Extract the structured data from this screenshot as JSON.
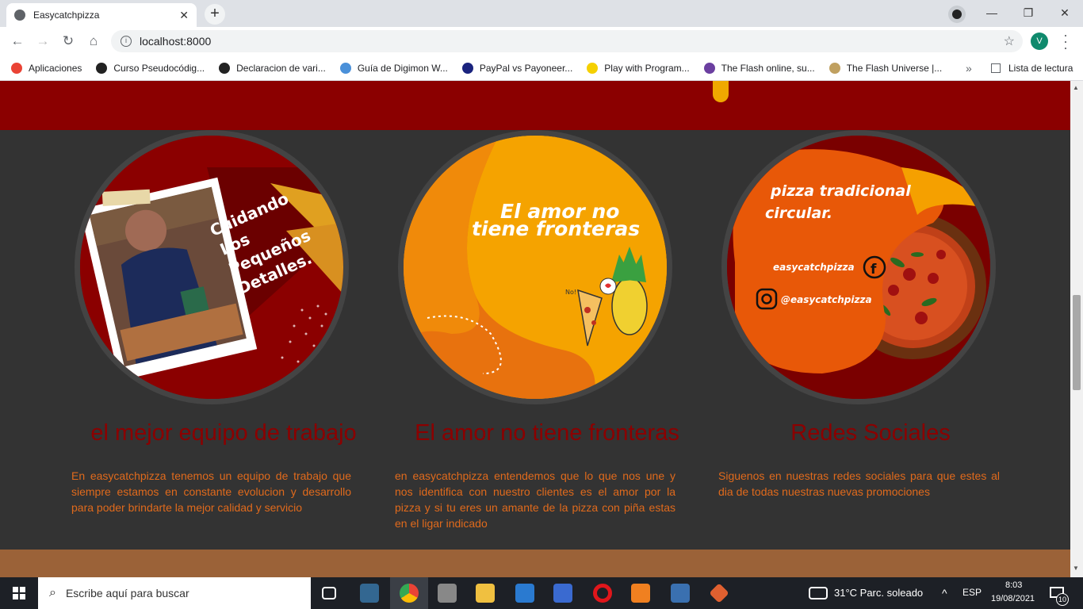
{
  "browser": {
    "tab_title": "Easycatchpizza",
    "tab_close": "✕",
    "new_tab": "+",
    "url": "localhost:8000",
    "profile_initial": "V",
    "window_min": "—",
    "window_max": "❐",
    "window_close": "✕",
    "bookmarks": [
      {
        "label": "Aplicaciones",
        "color": "#ea4335"
      },
      {
        "label": "Curso Pseudocódig...",
        "color": "#222222"
      },
      {
        "label": "Declaracion de vari...",
        "color": "#222222"
      },
      {
        "label": "Guía de Digimon W...",
        "color": "#4a90d9"
      },
      {
        "label": "PayPal vs Payoneer...",
        "color": "#1a237e"
      },
      {
        "label": "Play with Program...",
        "color": "#f5d000"
      },
      {
        "label": "The Flash online, su...",
        "color": "#6b3fa0"
      },
      {
        "label": "The Flash Universe |...",
        "color": "#c0a060"
      }
    ],
    "bookmarks_overflow": "»",
    "reading_list": "Lista de lectura"
  },
  "cards": [
    {
      "title": "el mejor equipo de trabajo",
      "text": "En easycatchpizza tenemos un equipo de trabajo que siempre estamos en constante evolucion y desarrollo para poder brindarte la mejor calidad y servicio",
      "image_text": "Cuidando Los Pequeños Detalles."
    },
    {
      "title": "El amor no tiene fronteras",
      "text": "en easycatchpizza entendemos que lo que nos une y nos identifica con nuestro clientes es el amor por la pizza y si tu eres un amante de la pizza con piña estas en el ligar indicado",
      "image_text_1": "El amor no",
      "image_text_2": "tiene fronteras",
      "bubble_text": "No!"
    },
    {
      "title": "Redes Sociales",
      "text": "Siguenos en nuestras redes sociales para que estes al dia de todas nuestras nuevas promociones",
      "image_text_1": "pizza tradicional",
      "image_text_2": "circular.",
      "facebook": "easycatchpizza",
      "instagram": "@easycatchpizza"
    }
  ],
  "taskbar": {
    "search_placeholder": "Escribe aquí para buscar",
    "weather": "31°C  Parc. soleado",
    "lang": "ESP",
    "time": "8:03",
    "date": "19/08/2021",
    "notifications": "10"
  },
  "colors": {
    "brand_red": "#8b0000",
    "accent_orange": "#e06a1c",
    "section_bg": "#333333"
  }
}
